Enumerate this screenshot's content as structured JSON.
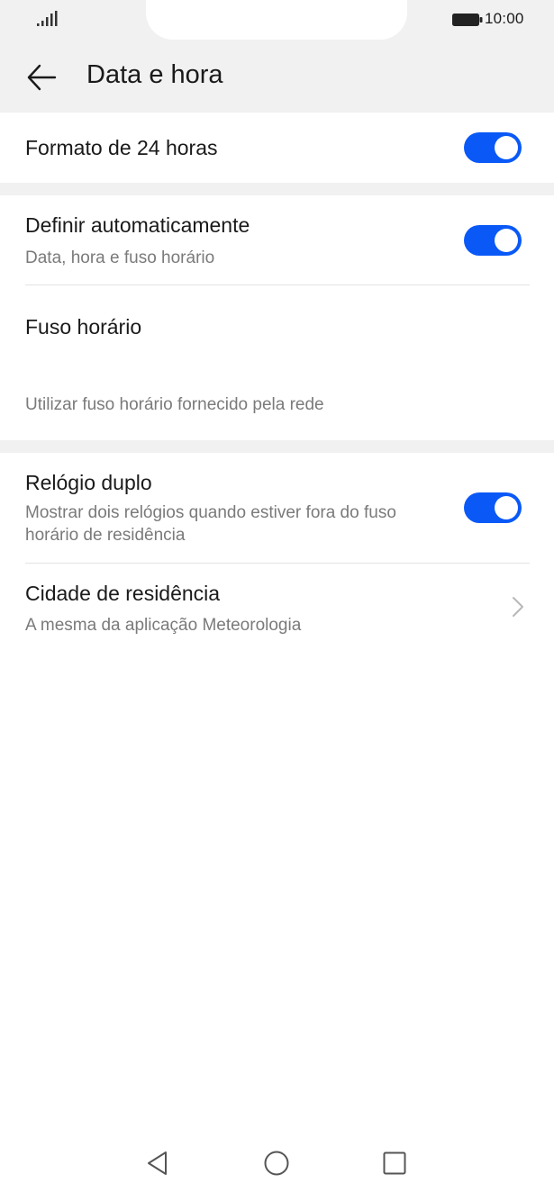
{
  "status_bar": {
    "time": "10:00",
    "icons": [
      "signal-icon",
      "battery-icon"
    ]
  },
  "header": {
    "title": "Data e hora",
    "back_icon": "arrow-left-icon"
  },
  "settings": {
    "format24": {
      "title": "Formato de 24 horas",
      "enabled": true
    },
    "auto_set": {
      "title": "Definir automaticamente",
      "subtitle": "Data, hora e fuso horário",
      "enabled": true
    },
    "timezone": {
      "title": "Fuso horário",
      "subtitle": "Utilizar fuso horário fornecido pela rede"
    },
    "dual_clock": {
      "title": "Relógio duplo",
      "subtitle": "Mostrar dois relógios quando estiver fora do fuso horário de residência",
      "enabled": true
    },
    "home_city": {
      "title": "Cidade de residência",
      "subtitle": "A mesma da aplicação Meteorologia",
      "chevron_icon": "chevron-right-icon"
    }
  },
  "nav_bar": {
    "buttons": [
      "back-triangle-icon",
      "home-circle-icon",
      "recents-square-icon"
    ]
  },
  "colors": {
    "accent": "#0a59f7",
    "header_bg": "#f1f1f1",
    "secondary_text": "#7a7a7a"
  }
}
